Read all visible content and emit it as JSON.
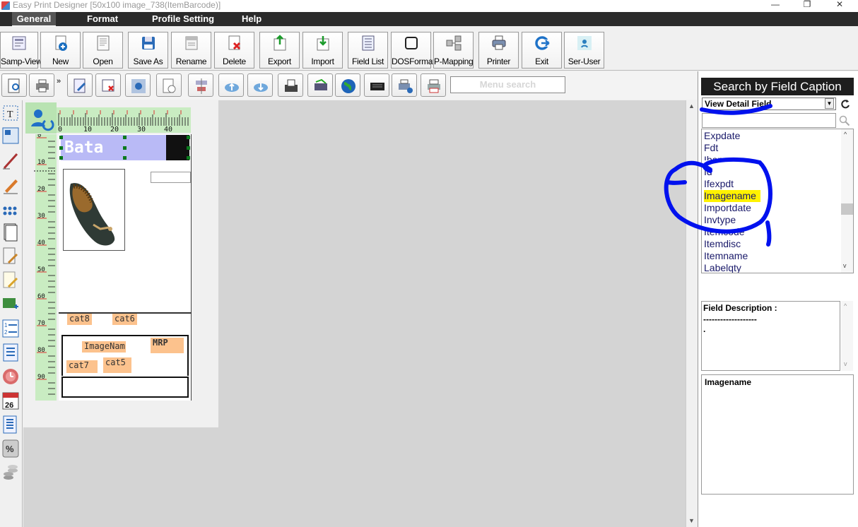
{
  "window": {
    "title": "Easy Print Designer [50x100 image_738(ItemBarcode)]",
    "minimize": "—",
    "maximize": "❐",
    "close": "✕"
  },
  "menus": [
    "General",
    "Format",
    "Profile Setting",
    "Help"
  ],
  "toolbar": {
    "buttons": [
      {
        "label": "Samp-View",
        "icon": "samp-view-icon"
      },
      {
        "label": "New",
        "icon": "new-file-icon"
      },
      {
        "label": "Open",
        "icon": "open-icon"
      },
      {
        "label": "Save As",
        "icon": "save-as-icon"
      },
      {
        "label": "Rename",
        "icon": "rename-icon"
      },
      {
        "label": "Delete",
        "icon": "delete-icon"
      },
      {
        "label": "Export",
        "icon": "export-icon"
      },
      {
        "label": "Import",
        "icon": "import-icon"
      },
      {
        "label": "Field List",
        "icon": "field-list-icon"
      },
      {
        "label": "DOSFormat",
        "icon": "dos-format-icon"
      },
      {
        "label": "P-Mapping",
        "icon": "p-mapping-icon"
      },
      {
        "label": "Printer",
        "icon": "printer-icon"
      },
      {
        "label": "Exit",
        "icon": "exit-icon"
      },
      {
        "label": "Ser-User",
        "icon": "ser-user-icon"
      }
    ]
  },
  "toolbar2": {
    "more": "»",
    "search_placeholder": "Menu search"
  },
  "ruler": {
    "h_ticks": [
      "0",
      "10",
      "20",
      "30",
      "40"
    ],
    "v_ticks": [
      "0",
      "10",
      "20",
      "30",
      "40",
      "50",
      "60",
      "70",
      "80",
      "90"
    ]
  },
  "label": {
    "brand": "Bata",
    "fields": [
      "cat8",
      "cat6",
      "ImageNam",
      "MRP",
      "cat7",
      "cat5"
    ]
  },
  "right_panel": {
    "header": "Search by Field Caption",
    "select_value": "View Detail Field",
    "refresh_icon": "refresh-icon",
    "search_icon": "search-icon",
    "fields": [
      "Expdate",
      "Fdt",
      "Ibamy",
      "Id",
      "Ifexpdt",
      "Imagename",
      "Importdate",
      "Invtype",
      "Itemcode",
      "Itemdisc",
      "Itemname",
      "Labelqty"
    ],
    "selected_field": "Imagename",
    "description_label": "Field Description :",
    "description_rule": "-------------------",
    "description_text": ".",
    "info_text": "Imagename"
  },
  "annotation_color": "#0011ee",
  "highlight_color": "#fff200"
}
